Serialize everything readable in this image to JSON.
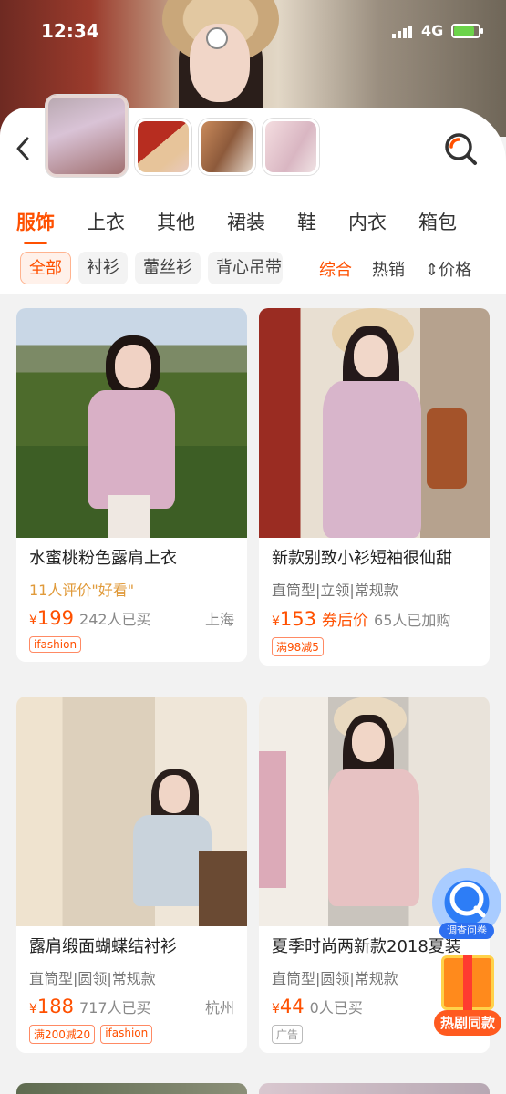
{
  "status_bar": {
    "time": "12:34",
    "network": "4G"
  },
  "header": {
    "back_icon": "chevron-left-icon",
    "search_icon": "image-search-icon"
  },
  "categories": [
    "服饰",
    "上衣",
    "其他",
    "裙装",
    "鞋",
    "内衣",
    "箱包"
  ],
  "active_category": "服饰",
  "filter_chips": [
    "全部",
    "衬衫",
    "蕾丝衫",
    "背心吊带"
  ],
  "sort_options": [
    "综合",
    "热销",
    "价格"
  ],
  "products": [
    {
      "title": "水蜜桃粉色露肩上衣",
      "sub": "11人评价\"好看\"",
      "price_symbol": "¥",
      "price": "199",
      "sold": "242人已买",
      "city": "上海",
      "tags": [
        "ifashion"
      ]
    },
    {
      "title": "新款别致小衫短袖很仙甜",
      "sub": "直筒型|立领|常规款",
      "price_symbol": "¥",
      "price": "153",
      "coupon": "券后价",
      "sold": "65人已加购",
      "tags": [
        "满98减5"
      ]
    },
    {
      "title": "露肩缎面蝴蝶结衬衫",
      "sub": "直筒型|圆领|常规款",
      "price_symbol": "¥",
      "price": "188",
      "sold": "717人已买",
      "city": "杭州",
      "tags": [
        "满200减20",
        "ifashion"
      ]
    },
    {
      "title": "夏季时尚两新款2018夏装",
      "sub": "直筒型|圆领|常规款",
      "price_symbol": "¥",
      "price": "44",
      "sold": "0人已买",
      "tags": [
        "广告"
      ]
    }
  ],
  "float_widgets": {
    "survey": "调查问卷",
    "gift": "热剧同款"
  },
  "colors": {
    "accent": "#ff5000"
  }
}
